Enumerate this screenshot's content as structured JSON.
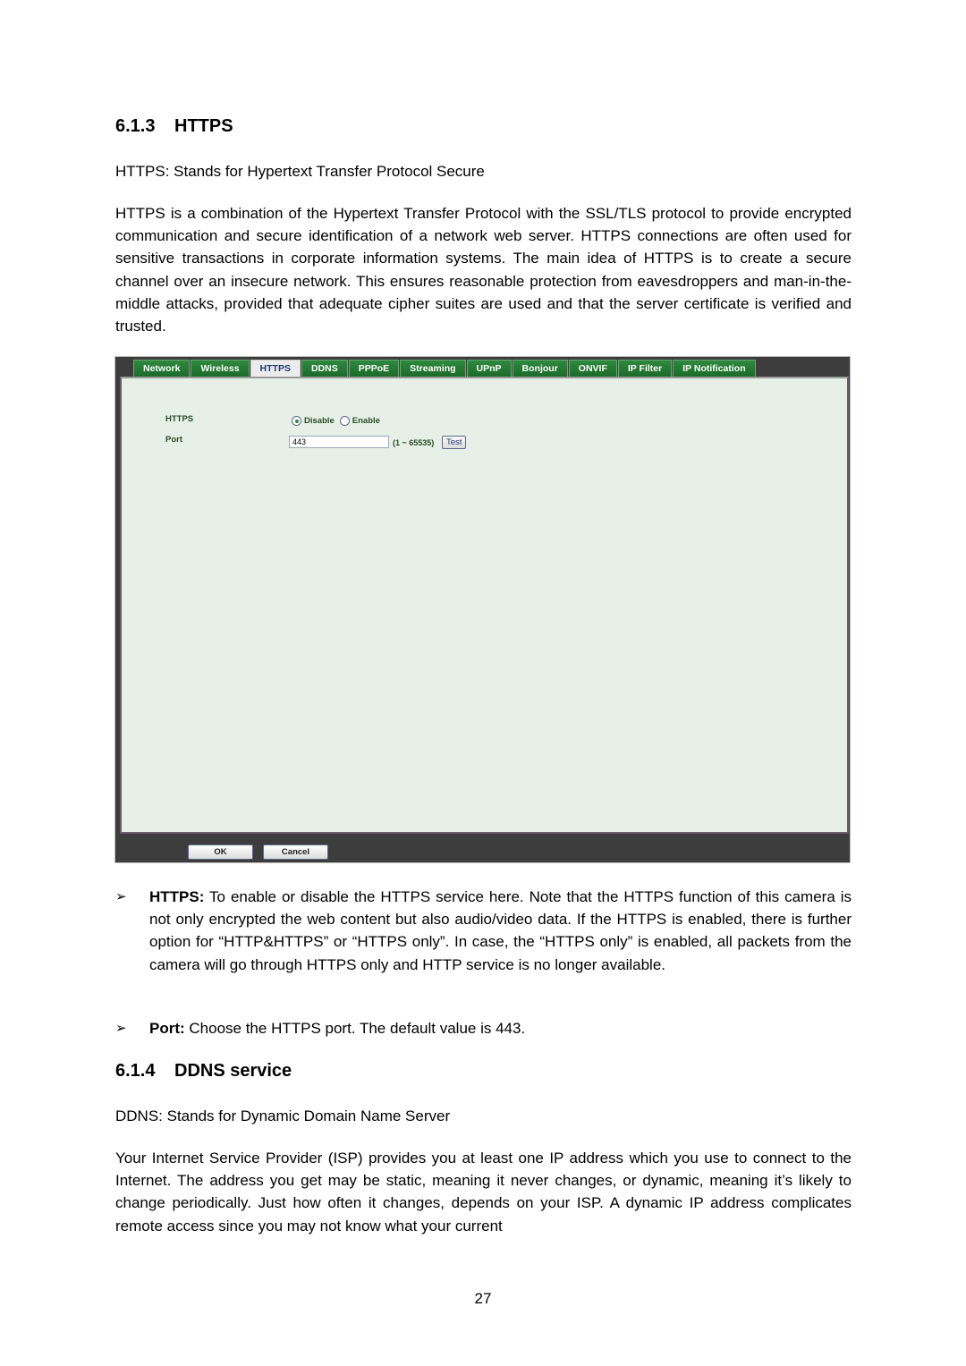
{
  "section_https": {
    "number": "6.1.3",
    "title": "HTTPS",
    "definition": "HTTPS: Stands for Hypertext Transfer Protocol Secure",
    "paragraph": "HTTPS is a combination of the Hypertext Transfer Protocol with the SSL/TLS protocol to provide encrypted communication and secure identification of a network web server. HTTPS connections are often used for sensitive transactions in corporate information systems. The main idea of HTTPS is to create a secure channel over an insecure network. This ensures reasonable protection from eavesdroppers and man-in-the-middle attacks, provided that adequate cipher suites are used and that the server certificate is verified and trusted."
  },
  "camera_ui": {
    "tabs": [
      {
        "label": "Network",
        "active": false
      },
      {
        "label": "Wireless",
        "active": false
      },
      {
        "label": "HTTPS",
        "active": true
      },
      {
        "label": "DDNS",
        "active": false
      },
      {
        "label": "PPPoE",
        "active": false
      },
      {
        "label": "Streaming",
        "active": false
      },
      {
        "label": "UPnP",
        "active": false
      },
      {
        "label": "Bonjour",
        "active": false
      },
      {
        "label": "ONVIF",
        "active": false
      },
      {
        "label": "IP Filter",
        "active": false
      },
      {
        "label": "IP Notification",
        "active": false
      }
    ],
    "https_label": "HTTPS",
    "https_options": [
      {
        "label": "Disable",
        "selected": true
      },
      {
        "label": "Enable",
        "selected": false
      }
    ],
    "port_label": "Port",
    "port_value": "443",
    "port_range": "(1 ~ 65535)",
    "test_label": "Test",
    "ok_label": "OK",
    "cancel_label": "Cancel",
    "colors": {
      "tab_green": "#2f8a3e",
      "frame_dark": "#3d3d3d",
      "panel_bg": "#e6f0e6"
    }
  },
  "bullets": [
    {
      "term": "HTTPS:",
      "text": " To enable or disable the HTTPS service here. Note that the HTTPS function of this camera is not only encrypted the web content but also audio/video data. If the HTTPS is enabled, there is further option for “HTTP&HTTPS” or “HTTPS only”. In case, the “HTTPS only” is enabled, all packets from the camera will go through HTTPS only and HTTP service is no longer available."
    },
    {
      "term": "Port:",
      "text": " Choose the HTTPS port. The default value is 443."
    }
  ],
  "bullet_mark": "➢",
  "section_ddns": {
    "number": "6.1.4",
    "title": "DDNS service",
    "definition": "DDNS: Stands for Dynamic Domain Name Server",
    "paragraph": "Your Internet Service Provider (ISP) provides you at least one IP address which you use to connect to the Internet. The address you get may be static, meaning it never changes, or dynamic, meaning it’s likely to change periodically. Just how often it changes, depends on your ISP. A dynamic IP address complicates remote access since you may not know what your current"
  },
  "page_number": "27"
}
